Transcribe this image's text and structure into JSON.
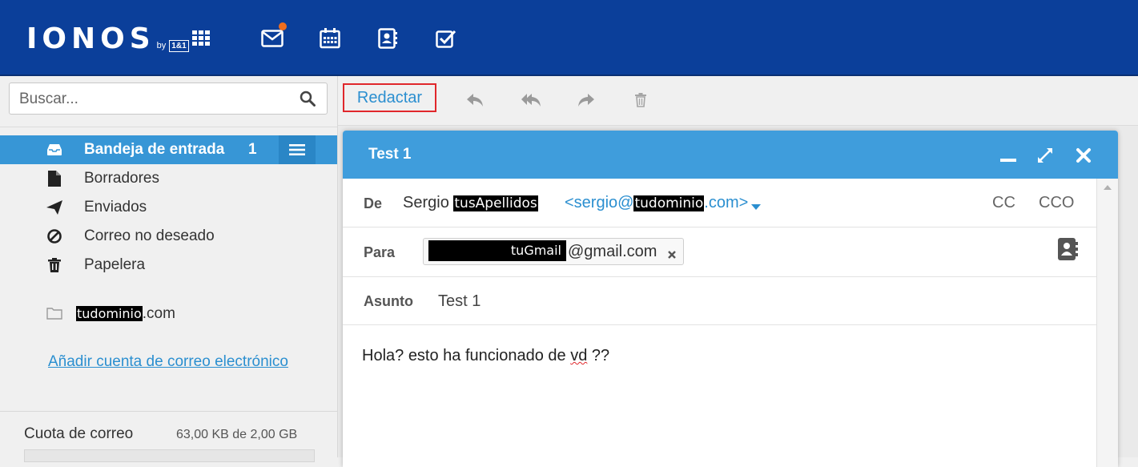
{
  "colors": {
    "topbar": "#0b3f9a",
    "accent": "#3796d6",
    "compose_header": "#3f9ddc",
    "link": "#2b8fd0",
    "highlight_border": "#e0272b",
    "notification_dot": "#f06e1e"
  },
  "topbar": {
    "brand": "IONOS",
    "by": "by",
    "partner": "1&1",
    "icons": [
      "apps-grid-icon",
      "mail-icon",
      "calendar-icon",
      "contacts-icon",
      "tasks-icon"
    ]
  },
  "sidebar": {
    "search_placeholder": "Buscar...",
    "folders": [
      {
        "label": "Bandeja de entrada",
        "count": "1",
        "icon": "inbox-icon"
      },
      {
        "label": "Borradores",
        "icon": "file-icon"
      },
      {
        "label": "Enviados",
        "icon": "paper-plane-icon"
      },
      {
        "label": "Correo no deseado",
        "icon": "ban-icon"
      },
      {
        "label": "Papelera",
        "icon": "trash-icon"
      }
    ],
    "account": {
      "redacted": "tudominio",
      "suffix": ".com"
    },
    "add_account": "Añadir cuenta de correo electrónico",
    "quota": {
      "label": "Cuota de correo",
      "value": "63,00 KB de 2,00 GB"
    }
  },
  "toolbar": {
    "compose_label": "Redactar",
    "actions": [
      "reply-icon",
      "reply-all-icon",
      "forward-icon",
      "delete-icon"
    ]
  },
  "compose": {
    "title": "Test 1",
    "from_label": "De",
    "from_name": "Sergio",
    "from_name_redacted": "tusApellidos",
    "from_email_prefix": "<sergio@",
    "from_email_redacted": "tudominio",
    "from_email_suffix": ".com>",
    "cc": "CC",
    "bcc": "CCO",
    "to_label": "Para",
    "to_redacted": "tuGmail",
    "to_domain": "@gmail.com",
    "subject_label": "Asunto",
    "subject_value": "Test 1",
    "body_before": "Hola? esto ha funcionado de ",
    "body_spell": "vd",
    "body_after": " ??"
  }
}
